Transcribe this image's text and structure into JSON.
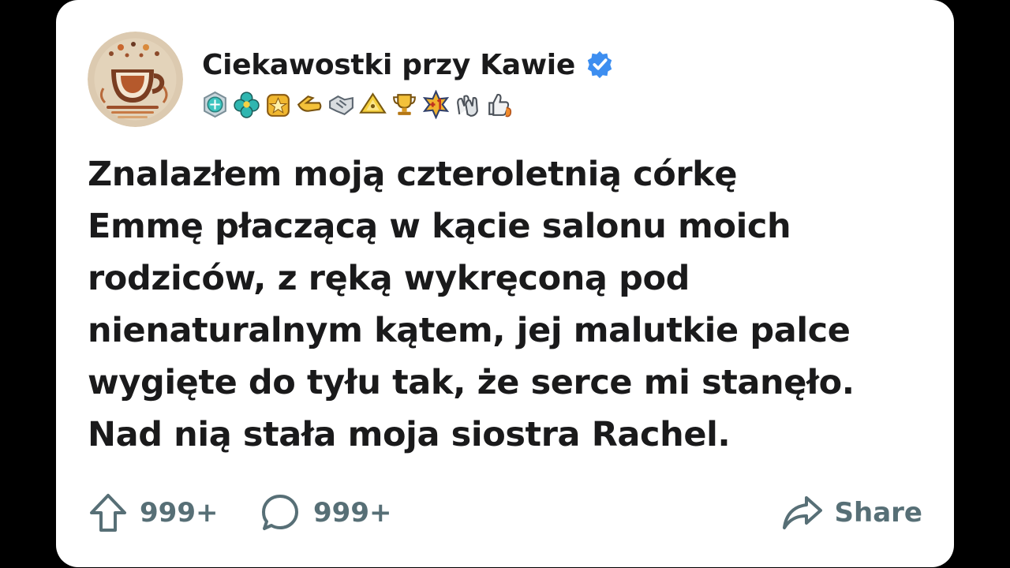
{
  "post": {
    "author": {
      "name": "Ciekawostki przy Kawie",
      "verified": true,
      "avatar_icon": "coffee-cup-logo-icon",
      "verified_icon": "verified-check-icon",
      "badge_icons": [
        "diamond-badge-icon",
        "clover-badge-icon",
        "gold-star-badge-icon",
        "pointing-hand-badge-icon",
        "handshake-badge-icon",
        "pyramid-badge-icon",
        "trophy-badge-icon",
        "plus-one-badge-icon",
        "clapping-hands-badge-icon",
        "thumbs-up-badge-icon"
      ]
    },
    "text_lines": [
      "Znalazłem moją czteroletnią córkę",
      "Emmę płaczącą w kącie salonu moich",
      "rodziców, z ręką wykręconą pod",
      "nienaturalnym kątem, jej malutkie palce",
      "wygięte do tyłu tak, że serce mi stanęło.",
      "Nad nią stała moja siostra Rachel."
    ],
    "actions": {
      "upvote_count": "999+",
      "comment_count": "999+",
      "share_label": "Share"
    }
  },
  "colors": {
    "background": "#000000",
    "card": "#ffffff",
    "text": "#1a1a1b",
    "action_gray": "#576f76",
    "verified_blue": "#3d8ef0"
  }
}
